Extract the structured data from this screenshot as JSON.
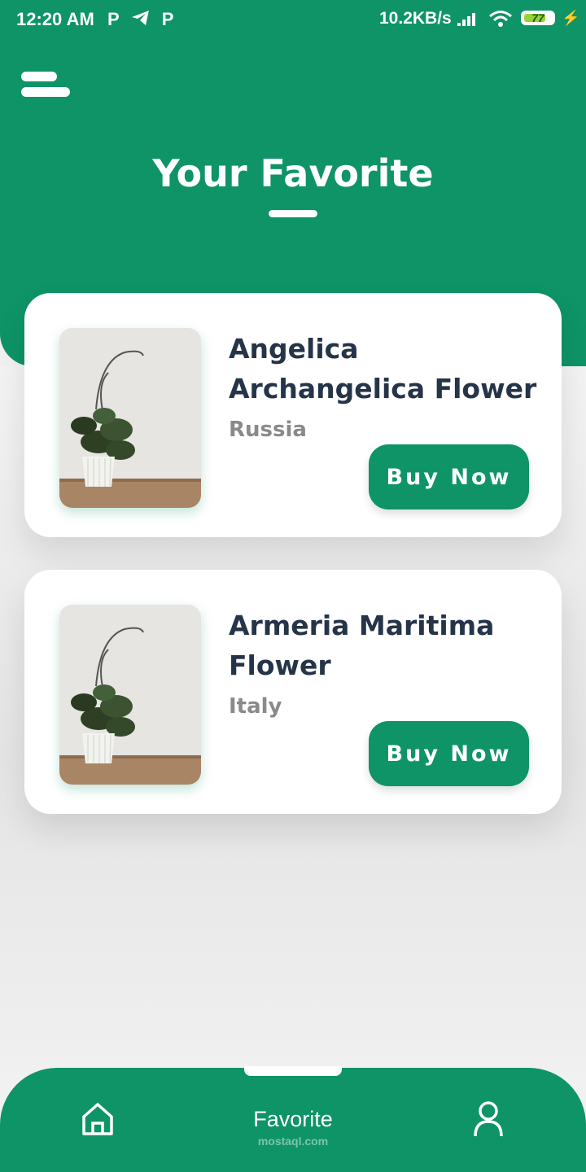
{
  "status_bar": {
    "time": "12:20 AM",
    "left_icons": [
      "p-icon",
      "telegram-icon",
      "p-icon"
    ],
    "net_speed": "10.2KB/s",
    "battery_level": "77",
    "battery_fraction": 0.77
  },
  "header": {
    "title": "Your Favorite"
  },
  "favorites": [
    {
      "name": "Angelica Archangelica Flower",
      "origin": "Russia",
      "action": "Buy Now"
    },
    {
      "name": "Armeria Maritima Flower",
      "origin": "Italy",
      "action": "Buy Now"
    }
  ],
  "bottom_nav": {
    "active_label": "Favorite",
    "watermark": "mostaql.com",
    "items": [
      "home-icon",
      "favorite",
      "profile-icon"
    ]
  },
  "colors": {
    "accent": "#0e9466",
    "text_dark": "#263449",
    "text_muted": "#8a8a8a",
    "background": "#f1f1f1"
  }
}
